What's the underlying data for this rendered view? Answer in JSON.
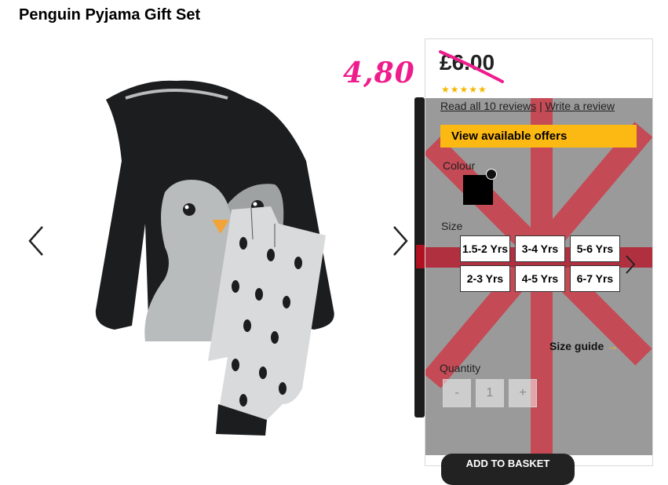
{
  "page": {
    "title": "Penguin Pyjama Gift Set"
  },
  "annotation": {
    "handwritten_price": "4,80"
  },
  "product": {
    "price": "£6.00",
    "rating_stars": 5,
    "stars_text": "★★★★★",
    "reviews_link": "Read all 10 reviews",
    "separator": "|",
    "write_review_link": "Write a review",
    "offers_button": "View available offers",
    "colour_label": "Colour",
    "selected_colour": "#000000",
    "size_label": "Size",
    "sizes": [
      "1.5-2 Yrs",
      "3-4 Yrs",
      "5-6 Yrs",
      "2-3 Yrs",
      "4-5 Yrs",
      "6-7 Yrs"
    ],
    "size_guide": "Size guide",
    "size_guide_arrow": "→",
    "quantity_label": "Quantity",
    "quantity_minus": "-",
    "quantity_value": "1",
    "quantity_plus": "+",
    "add_to_basket": "ADD TO BASKET"
  },
  "colors": {
    "accent": "#fdb913",
    "annotation": "#ee1d8c",
    "strike": "#ee1d8c"
  },
  "icons": {
    "prev": "chevron-left-icon",
    "next": "chevron-right-icon",
    "size_next": "chevron-right-icon"
  }
}
